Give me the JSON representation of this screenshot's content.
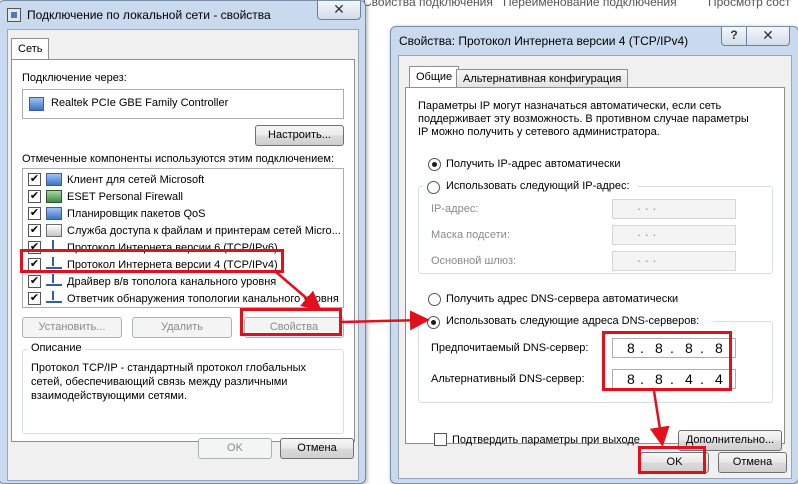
{
  "background_tabs": [
    "Свойства подключения",
    "Переименование подключения",
    "Просмотр сост"
  ],
  "window1": {
    "title": "Подключение по локальной сети - свойства",
    "close_label": "✕",
    "tab_label": "Сеть",
    "connect_using_label": "Подключение через:",
    "adapter_name": "Realtek PCIe GBE Family Controller",
    "configure_label": "Настроить...",
    "components_label": "Отмеченные компоненты используются этим подключением:",
    "components": [
      {
        "label": "Клиент для сетей Microsoft",
        "checked": true,
        "icon": "network-client-icon"
      },
      {
        "label": "ESET Personal Firewall",
        "checked": true,
        "icon": "firewall-icon"
      },
      {
        "label": "Планировщик пакетов QoS",
        "checked": true,
        "icon": "network-service-icon"
      },
      {
        "label": "Служба доступа к файлам и принтерам сетей Micro...",
        "checked": true,
        "icon": "file-sharing-icon"
      },
      {
        "label": "Протокол Интернета версии 6 (TCP/IPv6)",
        "checked": true,
        "icon": "protocol-icon"
      },
      {
        "label": "Протокол Интернета версии 4 (TCP/IPv4)",
        "checked": true,
        "icon": "protocol-icon"
      },
      {
        "label": "Драйвер в/в тополога канального уровня",
        "checked": true,
        "icon": "protocol-icon"
      },
      {
        "label": "Ответчик обнаружения топологии канального уровня",
        "checked": true,
        "icon": "protocol-icon"
      }
    ],
    "install_label": "Установить...",
    "remove_label": "Удалить",
    "properties_label": "Свойства",
    "description_title": "Описание",
    "description_text": [
      "Протокол TCP/IP - стандартный протокол глобальных",
      "сетей, обеспечивающий связь между различными",
      "взаимодействующими сетями."
    ],
    "ok_label": "OK",
    "cancel_label": "Отмена"
  },
  "window2": {
    "title": "Свойства: Протокол Интернета версии 4 (TCP/IPv4)",
    "help_label": "?",
    "close_label": "✕",
    "tab_general": "Общие",
    "tab_alternate": "Альтернативная конфигурация",
    "info_text": [
      "Параметры IP могут назначаться автоматически, если сеть",
      "поддерживает эту возможность. В противном случае параметры",
      "IP можно получить у сетевого администратора."
    ],
    "auto_ip_label": "Получить IP-адрес автоматически",
    "manual_ip_label": "Использовать следующий IP-адрес:",
    "ip_address_label": "IP-адрес:",
    "subnet_mask_label": "Маска подсети:",
    "default_gateway_label": "Основной шлюз:",
    "ip_dots": ".       .       .",
    "auto_dns_label": "Получить адрес DNS-сервера автоматически",
    "manual_dns_label": "Использовать следующие адреса DNS-серверов:",
    "preferred_dns_label": "Предпочитаемый DNS-сервер:",
    "alternate_dns_label": "Альтернативный DNS-сервер:",
    "preferred_dns": [
      "8",
      "8",
      "8",
      "8"
    ],
    "alternate_dns": [
      "8",
      "8",
      "4",
      "4"
    ],
    "validate_label": "Подтвердить параметры при выходе",
    "advanced_label": "Дополнительно...",
    "ok_label": "OK",
    "cancel_label": "Отмена"
  },
  "colors": {
    "highlight_red": "#e3101c",
    "title_bar": "#c9d9ee",
    "dialog_face": "#f0f0f0"
  }
}
